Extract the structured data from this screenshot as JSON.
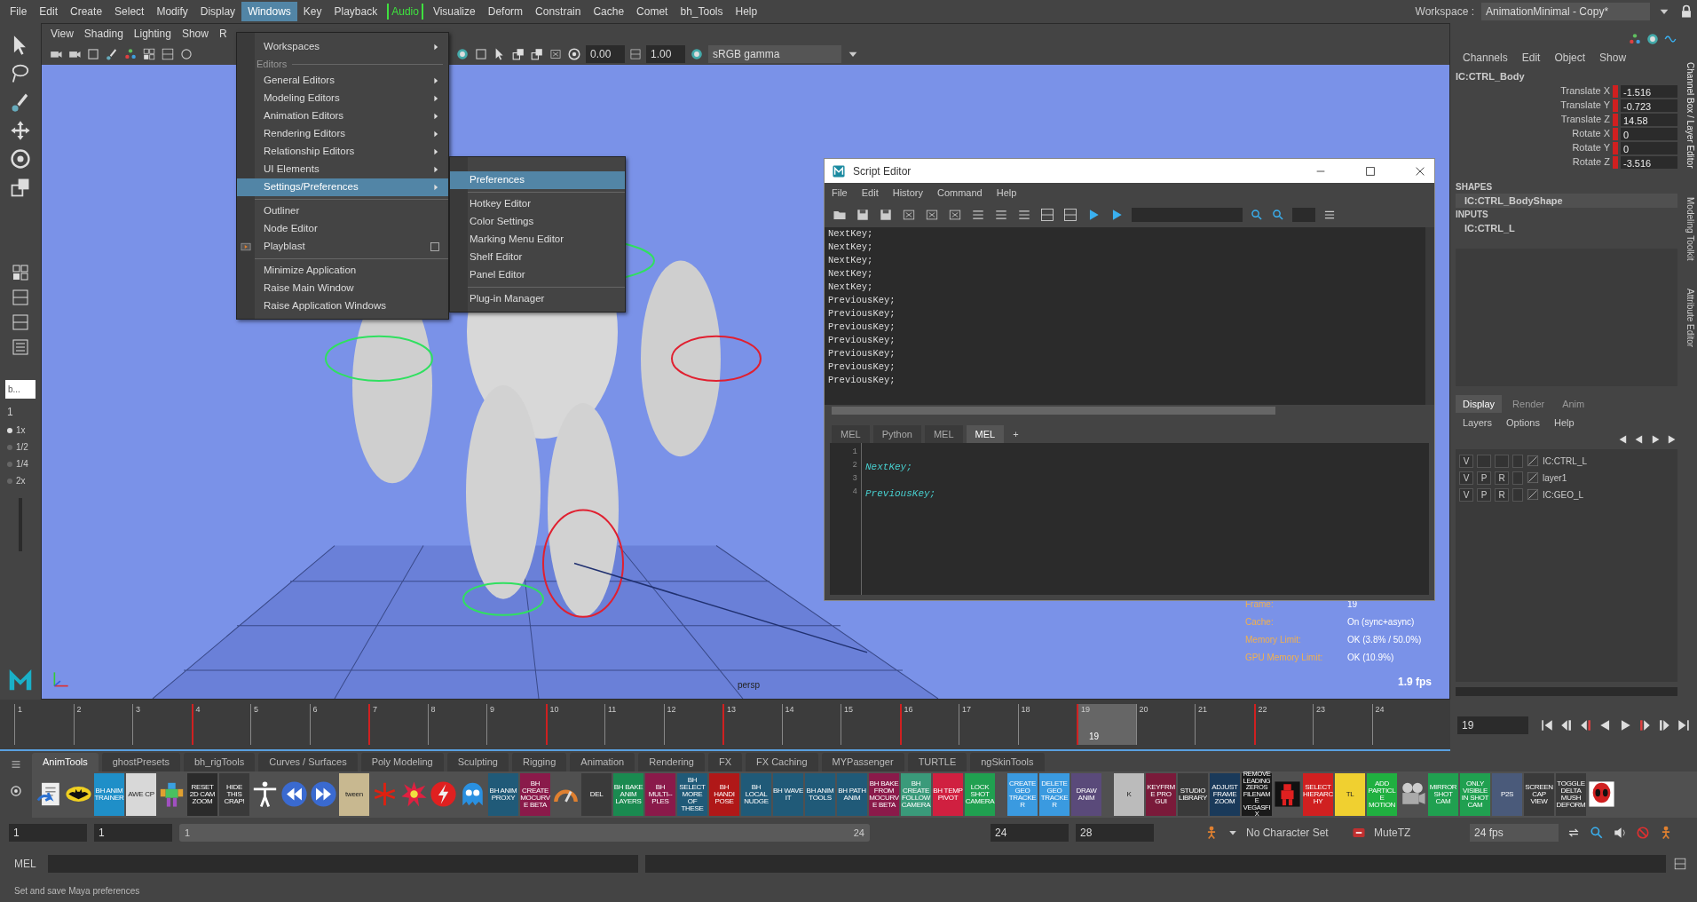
{
  "menubar": {
    "items": [
      {
        "label": "File",
        "selected": false,
        "kind": "menu"
      },
      {
        "label": "Edit",
        "selected": false,
        "kind": "menu"
      },
      {
        "label": "Create",
        "selected": false,
        "kind": "menu"
      },
      {
        "label": "Select",
        "selected": false,
        "kind": "menu"
      },
      {
        "label": "Modify",
        "selected": false,
        "kind": "menu"
      },
      {
        "label": "Display",
        "selected": false,
        "kind": "menu"
      },
      {
        "label": "Windows",
        "selected": true,
        "kind": "menu"
      },
      {
        "label": "Key",
        "selected": false,
        "kind": "menu"
      },
      {
        "label": "Playback",
        "selected": false,
        "kind": "menu"
      },
      {
        "label": "Audio",
        "selected": false,
        "kind": "bracketed"
      },
      {
        "label": "Visualize",
        "selected": false,
        "kind": "menu"
      },
      {
        "label": "Deform",
        "selected": false,
        "kind": "menu"
      },
      {
        "label": "Constrain",
        "selected": false,
        "kind": "menu"
      },
      {
        "label": "Cache",
        "selected": false,
        "kind": "menu"
      },
      {
        "label": "Comet",
        "selected": false,
        "kind": "menu"
      },
      {
        "label": "bh_Tools",
        "selected": false,
        "kind": "menu"
      },
      {
        "label": "Help",
        "selected": false,
        "kind": "menu"
      }
    ],
    "workspace_label": "Workspace :",
    "workspace": "AnimationMinimal - Copy*"
  },
  "toolbox": {
    "layout_field": "b...",
    "speed_label": "1",
    "speeds": [
      {
        "label": "1x",
        "selected": true
      },
      {
        "label": "1/2",
        "selected": false
      },
      {
        "label": "1/4",
        "selected": false
      },
      {
        "label": "2x",
        "selected": false
      }
    ]
  },
  "viewport": {
    "menu": [
      "View",
      "Shading",
      "Lighting",
      "Show",
      "R"
    ],
    "exposure": "0.00",
    "gamma": "1.00",
    "color_space": "sRGB gamma",
    "hud": [
      {
        "label": "Frame:",
        "value": "19"
      },
      {
        "label": "Cache:",
        "value": "On (sync+async)"
      },
      {
        "label": "Memory Limit:",
        "value": "OK (3.8% / 50.0%)"
      },
      {
        "label": "GPU Memory Limit:",
        "value": "OK (10.9%)"
      }
    ],
    "fps": "1.9 fps",
    "camera": "persp"
  },
  "windows_menu": {
    "items": [
      {
        "kind": "item",
        "label": "Workspaces",
        "submenu": true,
        "selected": false
      },
      {
        "kind": "section",
        "label": "Editors"
      },
      {
        "kind": "item",
        "label": "General Editors",
        "submenu": true,
        "selected": false
      },
      {
        "kind": "item",
        "label": "Modeling Editors",
        "submenu": true,
        "selected": false
      },
      {
        "kind": "item",
        "label": "Animation Editors",
        "submenu": true,
        "selected": false
      },
      {
        "kind": "item",
        "label": "Rendering Editors",
        "submenu": true,
        "selected": false
      },
      {
        "kind": "item",
        "label": "Relationship Editors",
        "submenu": true,
        "selected": false
      },
      {
        "kind": "item",
        "label": "UI Elements",
        "submenu": true,
        "selected": false
      },
      {
        "kind": "item",
        "label": "Settings/Preferences",
        "submenu": true,
        "selected": true
      },
      {
        "kind": "divider"
      },
      {
        "kind": "item",
        "label": "Outliner",
        "submenu": false,
        "selected": false
      },
      {
        "kind": "item",
        "label": "Node Editor",
        "submenu": false,
        "selected": false
      },
      {
        "kind": "item",
        "label": "Playblast",
        "submenu": false,
        "selected": false,
        "option_box": true
      },
      {
        "kind": "divider"
      },
      {
        "kind": "item",
        "label": "Minimize Application",
        "submenu": false,
        "selected": false
      },
      {
        "kind": "item",
        "label": "Raise Main Window",
        "submenu": false,
        "selected": false
      },
      {
        "kind": "item",
        "label": "Raise Application Windows",
        "submenu": false,
        "selected": false
      }
    ]
  },
  "settings_submenu": {
    "items": [
      {
        "kind": "item",
        "label": "Preferences",
        "selected": true
      },
      {
        "kind": "divider"
      },
      {
        "kind": "item",
        "label": "Hotkey Editor",
        "selected": false
      },
      {
        "kind": "item",
        "label": "Color Settings",
        "selected": false
      },
      {
        "kind": "item",
        "label": "Marking Menu Editor",
        "selected": false
      },
      {
        "kind": "item",
        "label": "Shelf Editor",
        "selected": false
      },
      {
        "kind": "item",
        "label": "Panel Editor",
        "selected": false
      },
      {
        "kind": "divider"
      },
      {
        "kind": "item",
        "label": "Plug-in Manager",
        "selected": false
      }
    ]
  },
  "script_editor": {
    "title": "Script Editor",
    "menu": [
      "File",
      "Edit",
      "History",
      "Command",
      "Help"
    ],
    "history": [
      "NextKey;",
      "NextKey;",
      "NextKey;",
      "NextKey;",
      "NextKey;",
      "PreviousKey;",
      "PreviousKey;",
      "PreviousKey;",
      "PreviousKey;",
      "PreviousKey;",
      "PreviousKey;",
      "PreviousKey;"
    ],
    "tabs": [
      {
        "label": "MEL",
        "selected": false
      },
      {
        "label": "Python",
        "selected": false
      },
      {
        "label": "MEL",
        "selected": false
      },
      {
        "label": "MEL",
        "selected": true
      }
    ],
    "add_tab": "+",
    "lines": [
      {
        "number": "1"
      },
      {
        "number": "2",
        "code": "NextKey;"
      },
      {
        "number": "3"
      },
      {
        "number": "4",
        "code": "PreviousKey;"
      }
    ]
  },
  "channel_box": {
    "menu": [
      "Channels",
      "Edit",
      "Object",
      "Show"
    ],
    "node": "IC:CTRL_Body",
    "channels": [
      {
        "name": "Translate X",
        "value": "-1.516",
        "keyed": true
      },
      {
        "name": "Translate Y",
        "value": "-0.723",
        "keyed": true
      },
      {
        "name": "Translate Z",
        "value": "14.58",
        "keyed": true
      },
      {
        "name": "Rotate X",
        "value": "0",
        "keyed": true
      },
      {
        "name": "Rotate Y",
        "value": "0",
        "keyed": true
      },
      {
        "name": "Rotate Z",
        "value": "-3.516",
        "keyed": true
      }
    ],
    "shapes_heading": "SHAPES",
    "shape": "IC:CTRL_BodyShape",
    "inputs_heading": "INPUTS",
    "input": "IC:CTRL_L"
  },
  "layer_editor": {
    "tabs": [
      {
        "label": "Display",
        "selected": true
      },
      {
        "label": "Render",
        "selected": false
      },
      {
        "label": "Anim",
        "selected": false
      }
    ],
    "menu": [
      "Layers",
      "Options",
      "Help"
    ],
    "layers": [
      {
        "v": "V",
        "name": "IC:CTRL_L"
      },
      {
        "v": "V",
        "p": "P",
        "r": "R",
        "name": "layer1"
      },
      {
        "v": "V",
        "p": "P",
        "r": "R",
        "name": "IC:GEO_L"
      }
    ]
  },
  "side_tabs": [
    "Channel Box / Layer Editor",
    "Modeling Toolkit",
    "Attribute Editor"
  ],
  "timeline": {
    "frames": [
      {
        "label": "1",
        "key": false
      },
      {
        "label": "2",
        "key": false
      },
      {
        "label": "3",
        "key": false
      },
      {
        "label": "4",
        "key": true
      },
      {
        "label": "5",
        "key": false
      },
      {
        "label": "6",
        "key": false
      },
      {
        "label": "7",
        "key": true
      },
      {
        "label": "8",
        "key": false
      },
      {
        "label": "9",
        "key": false
      },
      {
        "label": "10",
        "key": true
      },
      {
        "label": "11",
        "key": false
      },
      {
        "label": "12",
        "key": false
      },
      {
        "label": "13",
        "key": true
      },
      {
        "label": "14",
        "key": false
      },
      {
        "label": "15",
        "key": false
      },
      {
        "label": "16",
        "key": true
      },
      {
        "label": "17",
        "key": false
      },
      {
        "label": "18",
        "key": false
      },
      {
        "label": "19",
        "key": true,
        "selected": true
      },
      {
        "label": "20",
        "key": false
      },
      {
        "label": "21",
        "key": false
      },
      {
        "label": "22",
        "key": true
      },
      {
        "label": "23",
        "key": false
      },
      {
        "label": "24",
        "key": false
      }
    ],
    "current": "19",
    "frame_field": "19"
  },
  "shelf": {
    "tabs": [
      {
        "label": "AnimTools",
        "selected": true
      },
      {
        "label": "ghostPresets",
        "selected": false
      },
      {
        "label": "bh_rigTools",
        "selected": false
      },
      {
        "label": "Curves / Surfaces",
        "selected": false
      },
      {
        "label": "Poly Modeling",
        "selected": false
      },
      {
        "label": "Sculpting",
        "selected": false
      },
      {
        "label": "Rigging",
        "selected": false
      },
      {
        "label": "Animation",
        "selected": false
      },
      {
        "label": "Rendering",
        "selected": false
      },
      {
        "label": "FX",
        "selected": false
      },
      {
        "label": "FX Caching",
        "selected": false
      },
      {
        "label": "MYPassenger",
        "selected": false
      },
      {
        "label": "TURTLE",
        "selected": false
      },
      {
        "label": "ngSkinTools",
        "selected": false
      }
    ],
    "items": [
      {
        "kind": "script"
      },
      {
        "kind": "batman"
      },
      {
        "kind": "label",
        "text": "BH ANIM TRAINER",
        "color": "#1f8fc8"
      },
      {
        "kind": "label",
        "text": "AWE CP",
        "color": "#d8d8d8"
      },
      {
        "kind": "figure"
      },
      {
        "kind": "label",
        "text": "RESET 2D CAM ZOOM",
        "color": "#2b2b2b"
      },
      {
        "kind": "label",
        "text": "HIDE THIS CRAP!",
        "color": "#3a3a3a"
      },
      {
        "kind": "tpose"
      },
      {
        "kind": "back"
      },
      {
        "kind": "forward"
      },
      {
        "kind": "label",
        "text": "tween",
        "color": "#c8b890"
      },
      {
        "kind": "asterisk"
      },
      {
        "kind": "burst"
      },
      {
        "kind": "lightning"
      },
      {
        "kind": "ghost"
      },
      {
        "kind": "label",
        "text": "BH ANIM PROXY",
        "color": "#205a78"
      },
      {
        "kind": "label",
        "text": "BH CREATE MOCURVE BETA",
        "color": "#8a1a4a"
      },
      {
        "kind": "gauge"
      },
      {
        "kind": "label",
        "text": "DEL",
        "color": "#3a3a3a"
      },
      {
        "kind": "label",
        "text": "BH BAKE ANIM LAYERS",
        "color": "#1a8a50"
      },
      {
        "kind": "label",
        "text": "BH MULTI--PLES",
        "color": "#8a1a4a"
      },
      {
        "kind": "label",
        "text": "BH SELECT MORE OF THESE",
        "color": "#205a78"
      },
      {
        "kind": "label",
        "text": "BH HANDI POSE",
        "color": "#b01818"
      },
      {
        "kind": "label",
        "text": "BH LOCAL NUDGE",
        "color": "#205a78"
      },
      {
        "kind": "label",
        "text": "BH WAVE IT",
        "color": "#205a78"
      },
      {
        "kind": "label",
        "text": "BH ANIM TOOLS",
        "color": "#205a78"
      },
      {
        "kind": "label",
        "text": "BH PATH ANIM",
        "color": "#205a78"
      },
      {
        "kind": "label",
        "text": "BH BAKE FROM MOCURVE BETA",
        "color": "#8a1a4a"
      },
      {
        "kind": "label",
        "text": "BH CREATE FOLLOW CAMERA",
        "color": "#3a9a7a"
      },
      {
        "kind": "label",
        "text": "BH TEMP PIVOT",
        "color": "#d02040"
      },
      {
        "kind": "label",
        "text": "LOCK SHOT CAMERA",
        "color": "#20a050"
      },
      {
        "kind": "label",
        "text": "CREATE GEO TRACKER",
        "color": "#3a9ae0",
        "gap_before": true
      },
      {
        "kind": "label",
        "text": "DELETE GEO TRACKER",
        "color": "#3a9ae0"
      },
      {
        "kind": "label",
        "text": "DRAW ANIM",
        "color": "#5a4a7a"
      },
      {
        "kind": "label",
        "text": "K",
        "color": "#bbbbbb",
        "gap_before": true
      },
      {
        "kind": "label",
        "text": "KEYFRME PRO GUI",
        "color": "#7a1a3a"
      },
      {
        "kind": "label",
        "text": "STUDIO LIBRARY",
        "color": "#3a3a3a"
      },
      {
        "kind": "label",
        "text": "ADJUST FRAME ZOOM",
        "color": "#1a3a5a"
      },
      {
        "kind": "label",
        "text": "REMOVE LEADING ZEROS FILENAME VEGASFIX",
        "color": "#1a1a1a"
      },
      {
        "kind": "robot"
      },
      {
        "kind": "label",
        "text": "SELECT HIERARCHY",
        "color": "#d02020"
      },
      {
        "kind": "label",
        "text": "TL",
        "color": "#f0d030"
      },
      {
        "kind": "label",
        "text": "ADD PARTICLE MOTION",
        "color": "#20b040"
      },
      {
        "kind": "camera"
      },
      {
        "kind": "label",
        "text": "MIRROR SHOT CAM",
        "color": "#20a050"
      },
      {
        "kind": "label",
        "text": "ONLY VISIBLE IN SHOT CAM",
        "color": "#20a050"
      },
      {
        "kind": "label",
        "text": "P2S",
        "color": "#4a5a7a"
      },
      {
        "kind": "label",
        "text": "SCREEN CAP VIEW",
        "color": "#3a3a3a"
      },
      {
        "kind": "label",
        "text": "TOGGLE DELTA MUSH DEFORM",
        "color": "#3a3a3a"
      },
      {
        "kind": "alien"
      }
    ]
  },
  "range": {
    "start": "1",
    "playback_start": "1",
    "slider_start": "1",
    "slider_end": "24",
    "playback_end": "24",
    "end": "28",
    "character_set": "No Character Set",
    "mute": "MuteTZ",
    "fps": "24 fps"
  },
  "command_line": {
    "language": "MEL"
  },
  "help_line": "Set and save Maya preferences"
}
